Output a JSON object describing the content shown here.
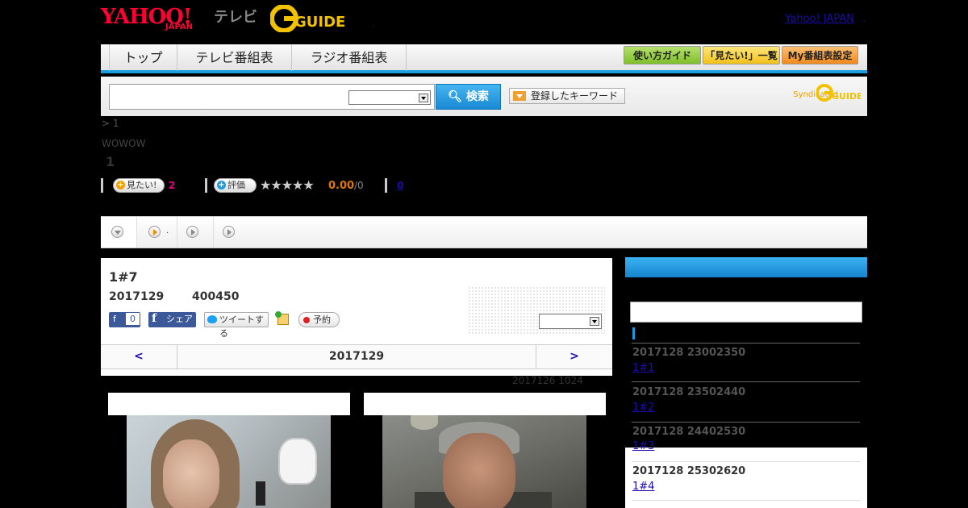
{
  "header": {
    "logo_yahoo": "YAHOO!",
    "logo_japan": "JAPAN",
    "logo_tv": "テレビ",
    "logo_gguide": "G-GUIDE",
    "sep_dot": ",",
    "yahoo_japan_link": "Yahoo! JAPAN",
    "yahoo_japan_dot": "."
  },
  "nav": {
    "tabs": [
      {
        "label": "トップ"
      },
      {
        "label": "テレビ番組表"
      },
      {
        "label": "ラジオ番組表"
      }
    ],
    "buttons": [
      {
        "label": "使い方ガイド"
      },
      {
        "label": "「見たい!」一覧"
      },
      {
        "label": "My番組表設定"
      }
    ]
  },
  "search": {
    "input_value": "",
    "select_value": "",
    "button_label": "検索",
    "keyword_button_label": "登録したキーワード",
    "syndicated_label": "Syndicated"
  },
  "meta": {
    "breadcrumb": ">  1",
    "channel": "WOWOW",
    "headline": "1"
  },
  "stats": {
    "want_label": "見たい!",
    "want_count": "2",
    "rate_label": "評価",
    "stars": "★★★★★",
    "score": "0.00",
    "score_count": "/0",
    "link_count": "0"
  },
  "tabs_strip": {
    "tab2_dot": "."
  },
  "program": {
    "title": "1#7",
    "date": "2017129",
    "time": "400450",
    "fb_count": "0",
    "fb_share": "シェア",
    "tweet": "ツイートする",
    "reserve": "予約",
    "select_value": "",
    "nav_prev": "<",
    "nav_date": "2017129",
    "nav_next": ">",
    "updated": "2017126  1024"
  },
  "sidebar": {
    "items": [
      {
        "time": "2017128  23002350",
        "title": "1#1"
      },
      {
        "time": "2017128  23502440",
        "title": "1#2"
      },
      {
        "time": "2017128  24402530",
        "title": "1#3"
      },
      {
        "time": "2017128  25302620",
        "title": "1#4"
      }
    ]
  },
  "colors": {
    "accent_blue": "#1aa0e0",
    "want_count_color": "#e6007e",
    "score_color": "#e07800"
  }
}
